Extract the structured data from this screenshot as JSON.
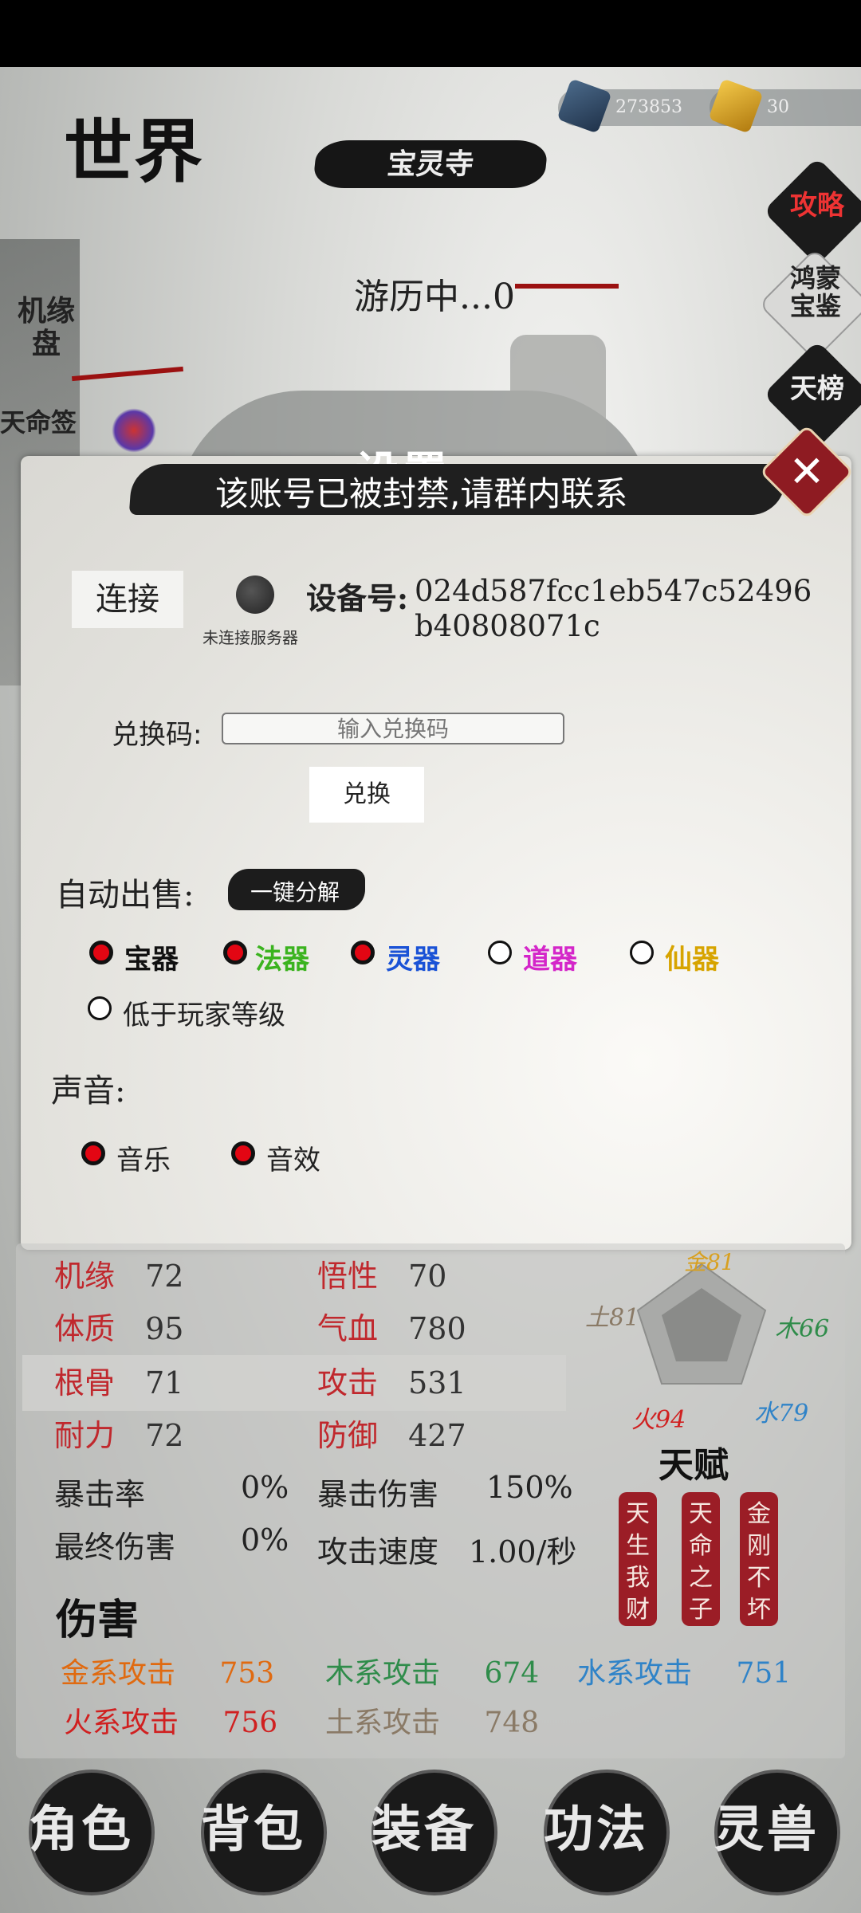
{
  "hud": {
    "crystal_count": "273853",
    "gold_count": "30",
    "world_title": "世界",
    "location_banner": "宝灵寺",
    "traveling_text": "游历中...0",
    "left_side": [
      "机缘盘",
      "天命签"
    ],
    "right_side": [
      "攻略",
      "鸿蒙宝鉴",
      "天榜"
    ]
  },
  "settings": {
    "title": "设置",
    "notice": "该账号已被封禁,请群内联系",
    "connect_label": "连接",
    "server_status": "未连接服务器",
    "device_label": "设备号:",
    "device_id_line1": "024d587fcc1eb547c52496",
    "device_id_line2": "b40808071c",
    "redeem_label": "兑换码:",
    "redeem_placeholder": "输入兑换码",
    "redeem_button": "兑换",
    "auto_sell_label": "自动出售:",
    "one_click_decompose": "一键分解",
    "sell_options": [
      {
        "label": "宝器",
        "checked": true,
        "color": "#111111"
      },
      {
        "label": "法器",
        "checked": true,
        "color": "#3bb31f"
      },
      {
        "label": "灵器",
        "checked": true,
        "color": "#1a52d6"
      },
      {
        "label": "道器",
        "checked": false,
        "color": "#d426c9"
      },
      {
        "label": "仙器",
        "checked": false,
        "color": "#d7a400"
      }
    ],
    "below_level_label": "低于玩家等级",
    "below_level_checked": false,
    "sound_label": "声音:",
    "sound_options": [
      {
        "label": "音乐",
        "checked": true
      },
      {
        "label": "音效",
        "checked": true
      }
    ]
  },
  "stats": {
    "rows": [
      [
        {
          "k": "机缘",
          "v": "72"
        },
        {
          "k": "悟性",
          "v": "70"
        }
      ],
      [
        {
          "k": "体质",
          "v": "95"
        },
        {
          "k": "气血",
          "v": "780"
        }
      ],
      [
        {
          "k": "根骨",
          "v": "71"
        },
        {
          "k": "攻击",
          "v": "531"
        }
      ],
      [
        {
          "k": "耐力",
          "v": "72"
        },
        {
          "k": "防御",
          "v": "427"
        }
      ]
    ],
    "crit_rate_label": "暴击率",
    "crit_rate": "0%",
    "crit_dmg_label": "暴击伤害",
    "crit_dmg": "150%",
    "final_dmg_label": "最终伤害",
    "final_dmg": "0%",
    "atk_speed_label": "攻击速度",
    "atk_speed": "1.00/秒",
    "damage_title": "伤害",
    "elemental": [
      {
        "label": "金系攻击",
        "value": "753",
        "color": "#e06a10"
      },
      {
        "label": "木系攻击",
        "value": "674",
        "color": "#2f8c4a"
      },
      {
        "label": "水系攻击",
        "value": "751",
        "color": "#2f83c8"
      },
      {
        "label": "火系攻击",
        "value": "756",
        "color": "#d02020"
      },
      {
        "label": "土系攻击",
        "value": "748",
        "color": "#8a7a66"
      }
    ],
    "radar": {
      "gold": "金81",
      "wood": "木66",
      "water": "水79",
      "fire": "火94",
      "earth": "土81"
    },
    "talent_title": "天赋",
    "talents": [
      "天生我财",
      "天命之子",
      "金刚不坏"
    ]
  },
  "nav": [
    "角色",
    "背包",
    "装备",
    "功法",
    "灵兽"
  ]
}
